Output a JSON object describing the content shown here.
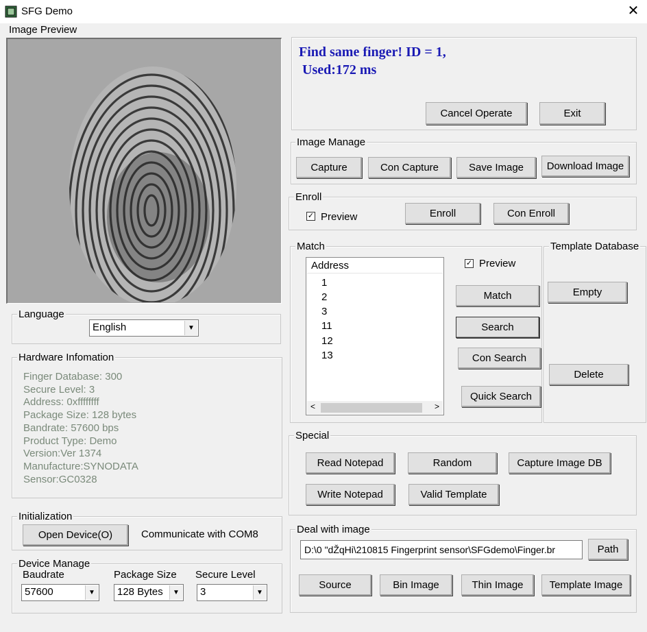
{
  "window": {
    "title": "SFG Demo"
  },
  "image_preview": {
    "label": "Image Preview"
  },
  "message": {
    "line1": "Find same finger! ID = 1,",
    "line2": " Used:172 ms"
  },
  "top_buttons": {
    "cancel": "Cancel Operate",
    "exit": "Exit"
  },
  "image_manage": {
    "label": "Image Manage",
    "capture": "Capture",
    "con_capture": "Con Capture",
    "save_image": "Save Image",
    "download_image": "Download Image"
  },
  "enroll": {
    "label": "Enroll",
    "preview": "Preview",
    "enroll": "Enroll",
    "con_enroll": "Con Enroll",
    "preview_checked": true
  },
  "match": {
    "label": "Match",
    "list_header": "Address",
    "items": [
      "1",
      "2",
      "3",
      "11",
      "12",
      "13"
    ],
    "preview": "Preview",
    "preview_checked": true,
    "match": "Match",
    "search": "Search",
    "con_search": "Con Search",
    "quick_search": "Quick Search"
  },
  "template_db": {
    "label": "Template Database",
    "empty": "Empty",
    "delete": "Delete"
  },
  "special": {
    "label": "Special",
    "read_notepad": "Read Notepad",
    "random": "Random",
    "capture_image_db": "Capture Image DB",
    "write_notepad": "Write Notepad",
    "valid_template": "Valid Template"
  },
  "deal_image": {
    "label": "Deal with image",
    "path_value": "D:\\0 \"dŽqHi\\210815 Fingerprint sensor\\SFGdemo\\Finger.br",
    "path": "Path",
    "source": "Source",
    "bin_image": "Bin Image",
    "thin_image": "Thin Image",
    "template_image": "Template Image"
  },
  "language": {
    "label": "Language",
    "selected": "English"
  },
  "hardware": {
    "label": "Hardware Infomation",
    "lines": [
      "Finger Database: 300",
      "Secure Level: 3",
      "Address: 0xffffffff",
      "Package Size: 128 bytes",
      "Bandrate: 57600 bps",
      "Product Type:  Demo",
      "Version:Ver 1374",
      "Manufacture:SYNODATA",
      "Sensor:GC0328"
    ]
  },
  "initialization": {
    "label": "Initialization",
    "open_device": "Open Device(O)",
    "status": "Communicate with COM8"
  },
  "device_manage": {
    "label": "Device Manage",
    "baudrate_label": "Baudrate",
    "baudrate": "57600",
    "package_label": "Package Size",
    "package": "128 Bytes",
    "secure_label": "Secure Level",
    "secure": "3"
  },
  "colors": {
    "message": "#1a1ab4",
    "hardware_text": "#7a8a7a",
    "preview_bg": "#a7a7a7"
  },
  "icons": {
    "app": "fingerprint-app-icon",
    "close": "close-icon"
  }
}
